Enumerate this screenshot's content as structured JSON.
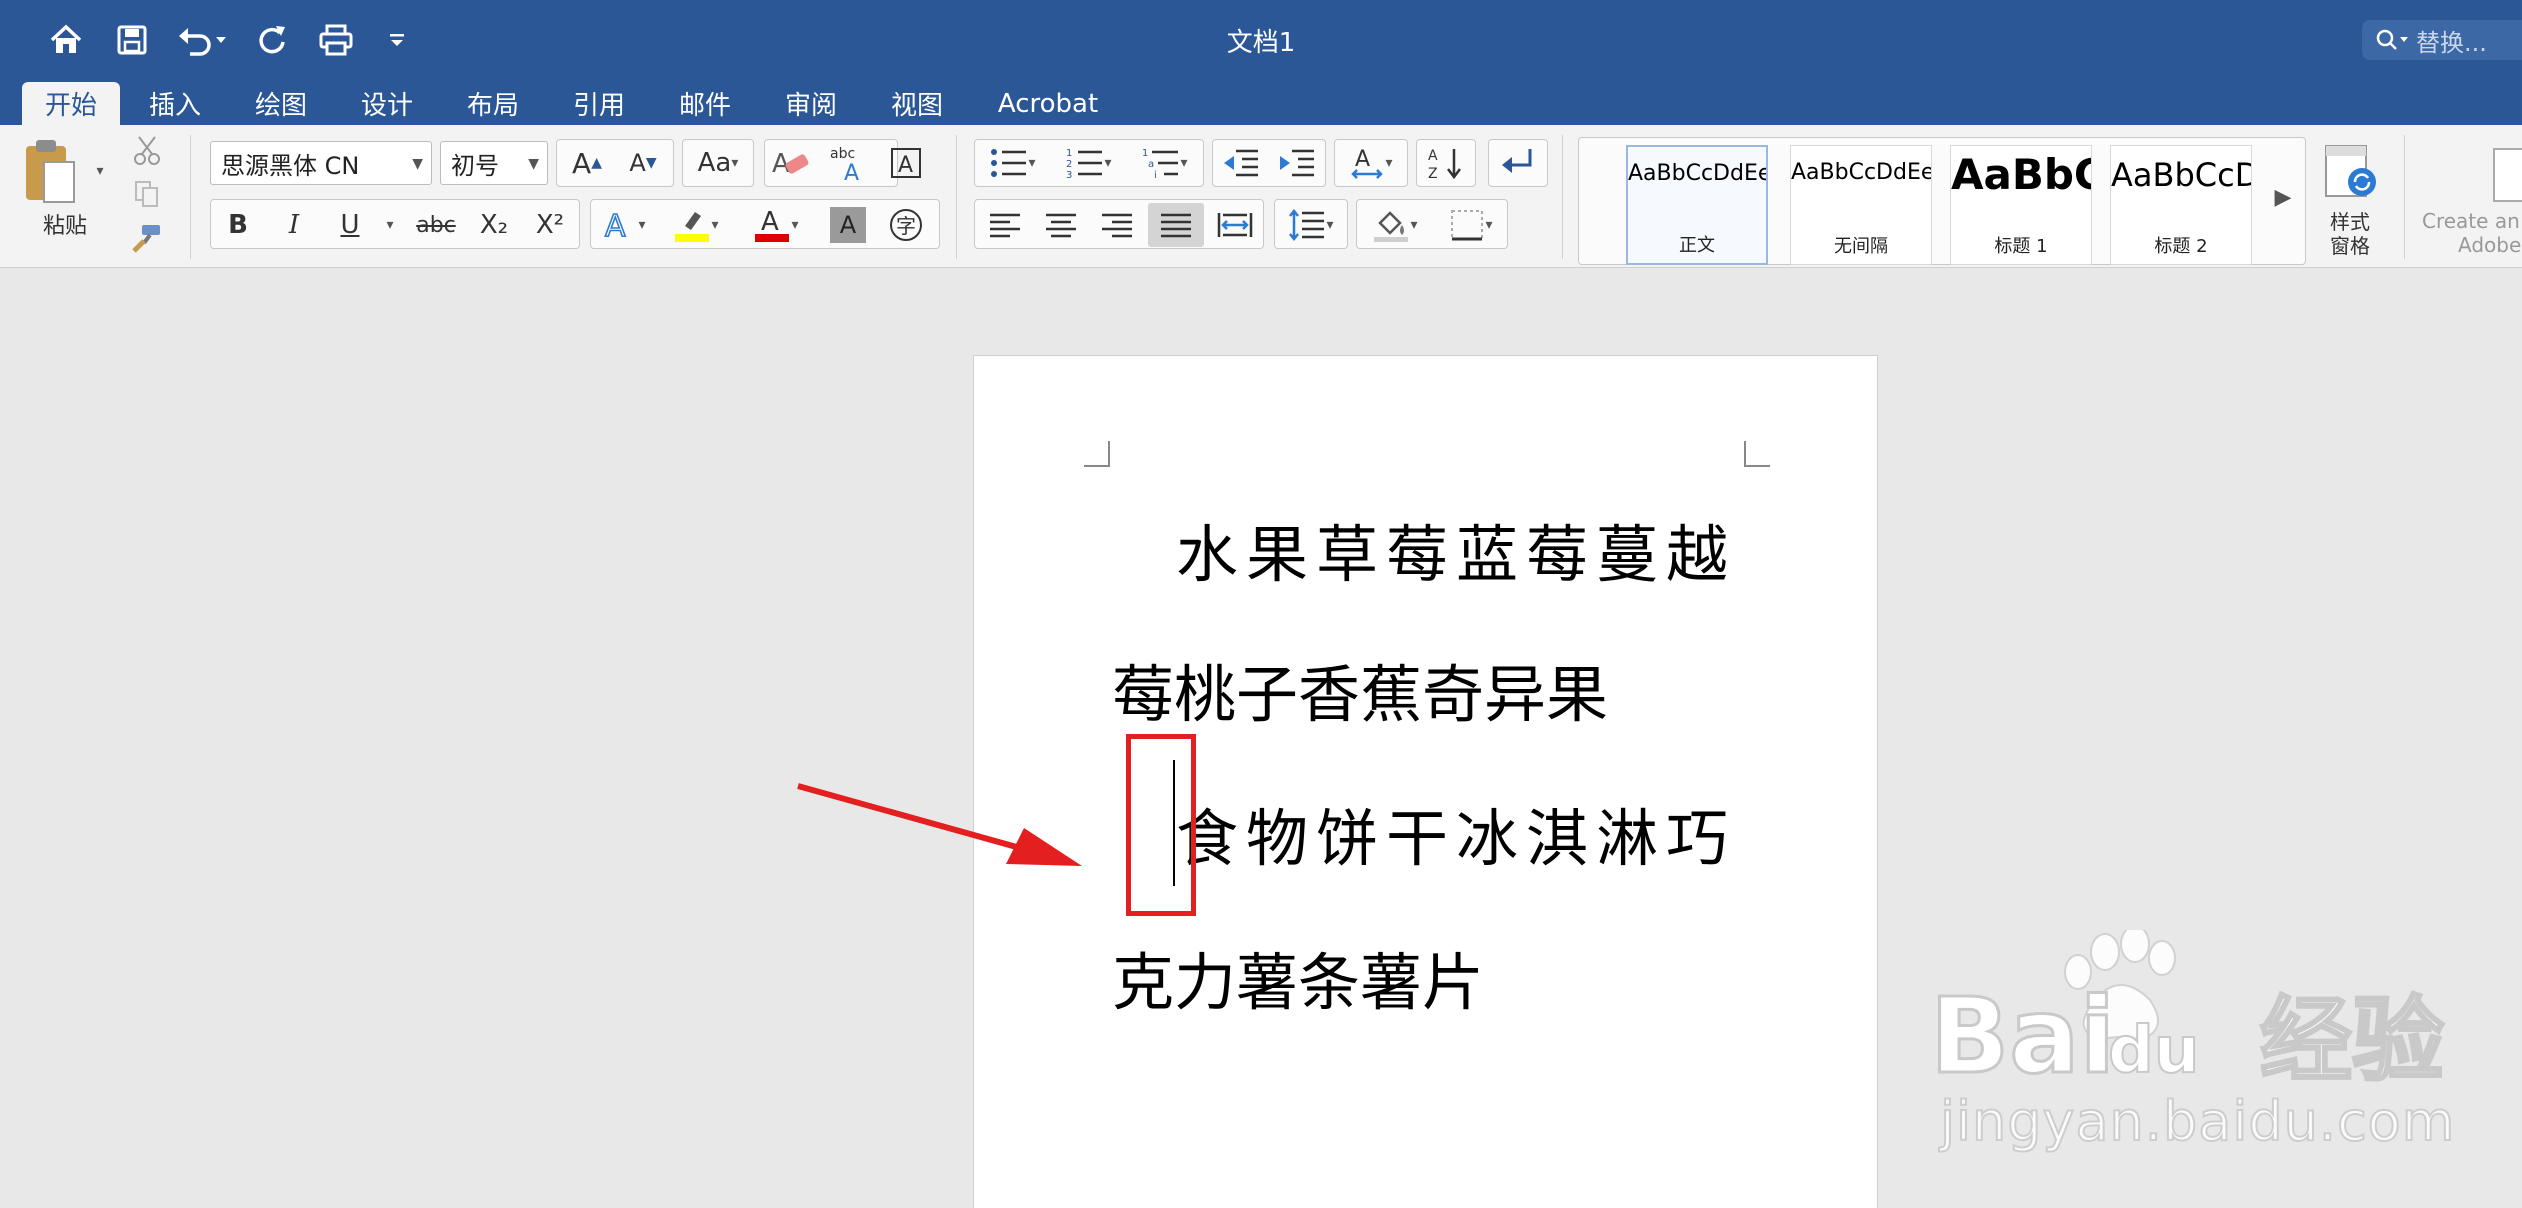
{
  "window": {
    "title": "文档1",
    "search_placeholder": "替换..."
  },
  "tabs": [
    "开始",
    "插入",
    "绘图",
    "设计",
    "布局",
    "引用",
    "邮件",
    "审阅",
    "视图",
    "Acrobat"
  ],
  "active_tab": "开始",
  "ribbon": {
    "paste_label": "粘贴",
    "font_name": "思源黑体 CN",
    "font_size": "初号",
    "format_buttons": {
      "bold": "B",
      "italic": "I",
      "underline": "U",
      "strike": "abc",
      "subscript": "X₂",
      "superscript": "X²"
    },
    "styles": [
      {
        "preview": "AaBbCcDdEe",
        "name": "正文",
        "selected": true
      },
      {
        "preview": "AaBbCcDdEe",
        "name": "无间隔",
        "selected": false
      },
      {
        "preview": "AaBbC",
        "name": "标题 1",
        "selected": false
      },
      {
        "preview": "AaBbCcD",
        "name": "标题 2",
        "selected": false
      }
    ],
    "styles_pane_label_line1": "样式",
    "styles_pane_label_line2": "窗格",
    "create_label_line1": "Create an",
    "create_label_line2": "Adobe"
  },
  "document": {
    "lines": [
      "水果草莓蓝莓蔓越",
      "莓桃子香蕉奇异果",
      "食物饼干冰淇淋巧",
      "克力薯条薯片"
    ]
  },
  "watermark": {
    "brand": "Bai",
    "brand_cn": "经验",
    "brand_du": "du",
    "url": "jingyan.baidu.com"
  },
  "colors": {
    "titlebar": "#2b5797",
    "annotation": "#e41f1f",
    "highlight_yellow": "#ffff00",
    "font_red": "#e00000"
  }
}
